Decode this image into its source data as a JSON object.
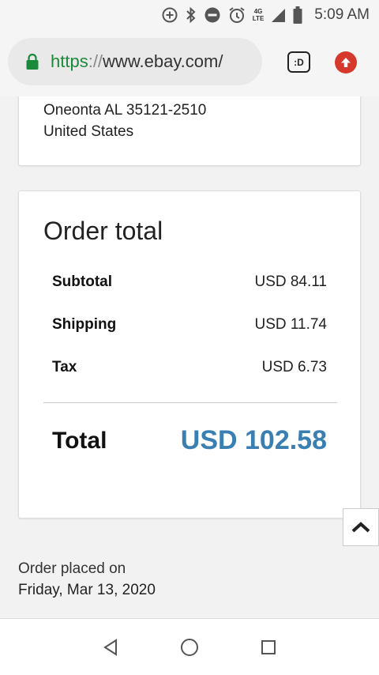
{
  "status_bar": {
    "network_type_top": "4G",
    "network_type_bottom": "LTE",
    "time": "5:09 AM"
  },
  "browser": {
    "url_scheme": "https",
    "url_separator": "://",
    "url_host": "www.ebay.com/",
    "tab_switcher_label": ":D"
  },
  "address": {
    "city_line": "Oneonta AL 35121-2510",
    "country": "United States"
  },
  "order_total": {
    "title": "Order total",
    "rows": [
      {
        "label": "Subtotal",
        "value": "USD 84.11"
      },
      {
        "label": "Shipping",
        "value": "USD 11.74"
      },
      {
        "label": "Tax",
        "value": "USD 6.73"
      }
    ],
    "total_label": "Total",
    "total_value": "USD 102.58"
  },
  "order_placed": {
    "label": "Order placed on",
    "date": "Friday, Mar 13, 2020"
  },
  "colors": {
    "total_accent": "#3a7fb2",
    "secure_green": "#1a8a3a",
    "upload_red": "#d6392b"
  }
}
